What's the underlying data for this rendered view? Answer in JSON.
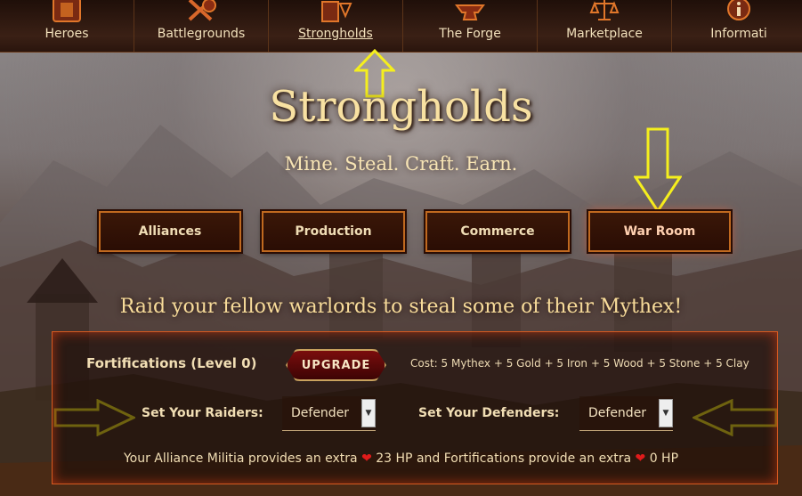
{
  "nav": {
    "items": [
      {
        "label": "Heroes",
        "icon": "shield-icon"
      },
      {
        "label": "Battlegrounds",
        "icon": "crossed-swords-icon"
      },
      {
        "label": "Strongholds",
        "icon": "castle-icon",
        "active": true
      },
      {
        "label": "The Forge",
        "icon": "anvil-icon"
      },
      {
        "label": "Marketplace",
        "icon": "scales-icon"
      },
      {
        "label": "Informati",
        "icon": "info-icon"
      }
    ]
  },
  "hero": {
    "title": "Strongholds",
    "subtitle": "Mine. Steal. Craft. Earn."
  },
  "tabs": [
    {
      "label": "Alliances"
    },
    {
      "label": "Production"
    },
    {
      "label": "Commerce"
    },
    {
      "label": "War Room",
      "active": true
    }
  ],
  "war_room": {
    "heading": "Raid your fellow warlords to steal some of their Mythex!",
    "fortifications_label": "Fortifications (Level 0)",
    "upgrade_label": "UPGRADE",
    "cost": "Cost: 5 Mythex + 5 Gold + 5 Iron + 5 Wood + 5 Stone + 5 Clay",
    "raiders_label": "Set Your Raiders:",
    "raiders_value": "Defender",
    "defenders_label": "Set Your Defenders:",
    "defenders_value": "Defender",
    "militia_prefix": "Your Alliance Militia provides an extra",
    "militia_hp": "23 HP and Fortifications provide an extra",
    "fort_hp": "0 HP"
  },
  "colors": {
    "accent": "#c0691f",
    "annotation": "#f5ef1d",
    "heart": "#e01b1b"
  }
}
